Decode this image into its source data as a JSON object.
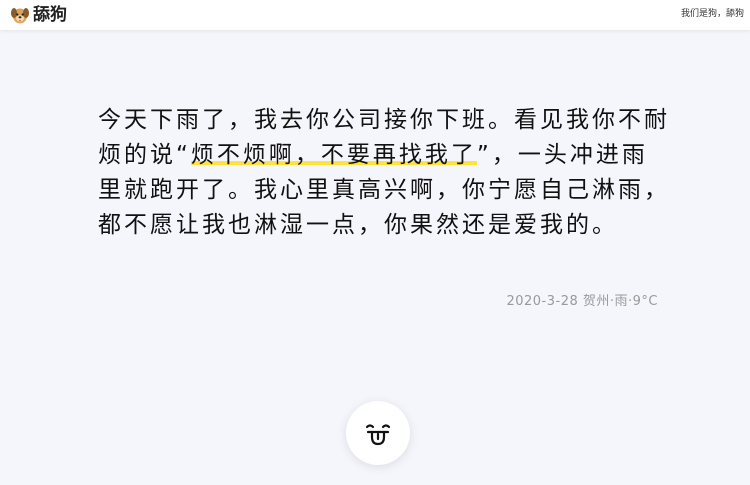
{
  "header": {
    "logo_text": "舔狗",
    "right_text": "我们是狗，舔狗"
  },
  "quote": {
    "part1": "今天下雨了，我去你公司接你下班。看见我你不耐烦的说“",
    "highlight": "烦不烦啊，不要再找我了",
    "part2": "”，一头冲进雨里就跑开了。我心里真高兴啊，你宁愿自己淋雨，都不愿让我也淋湿一点，你果然还是爱我的。"
  },
  "meta": {
    "text": "2020-3-28 贺州·雨·9°C"
  },
  "icons": {
    "logo": "dog-icon",
    "action": "tongue-face-icon"
  },
  "colors": {
    "highlight": "#ffe23d",
    "background": "#f5f5fc"
  }
}
